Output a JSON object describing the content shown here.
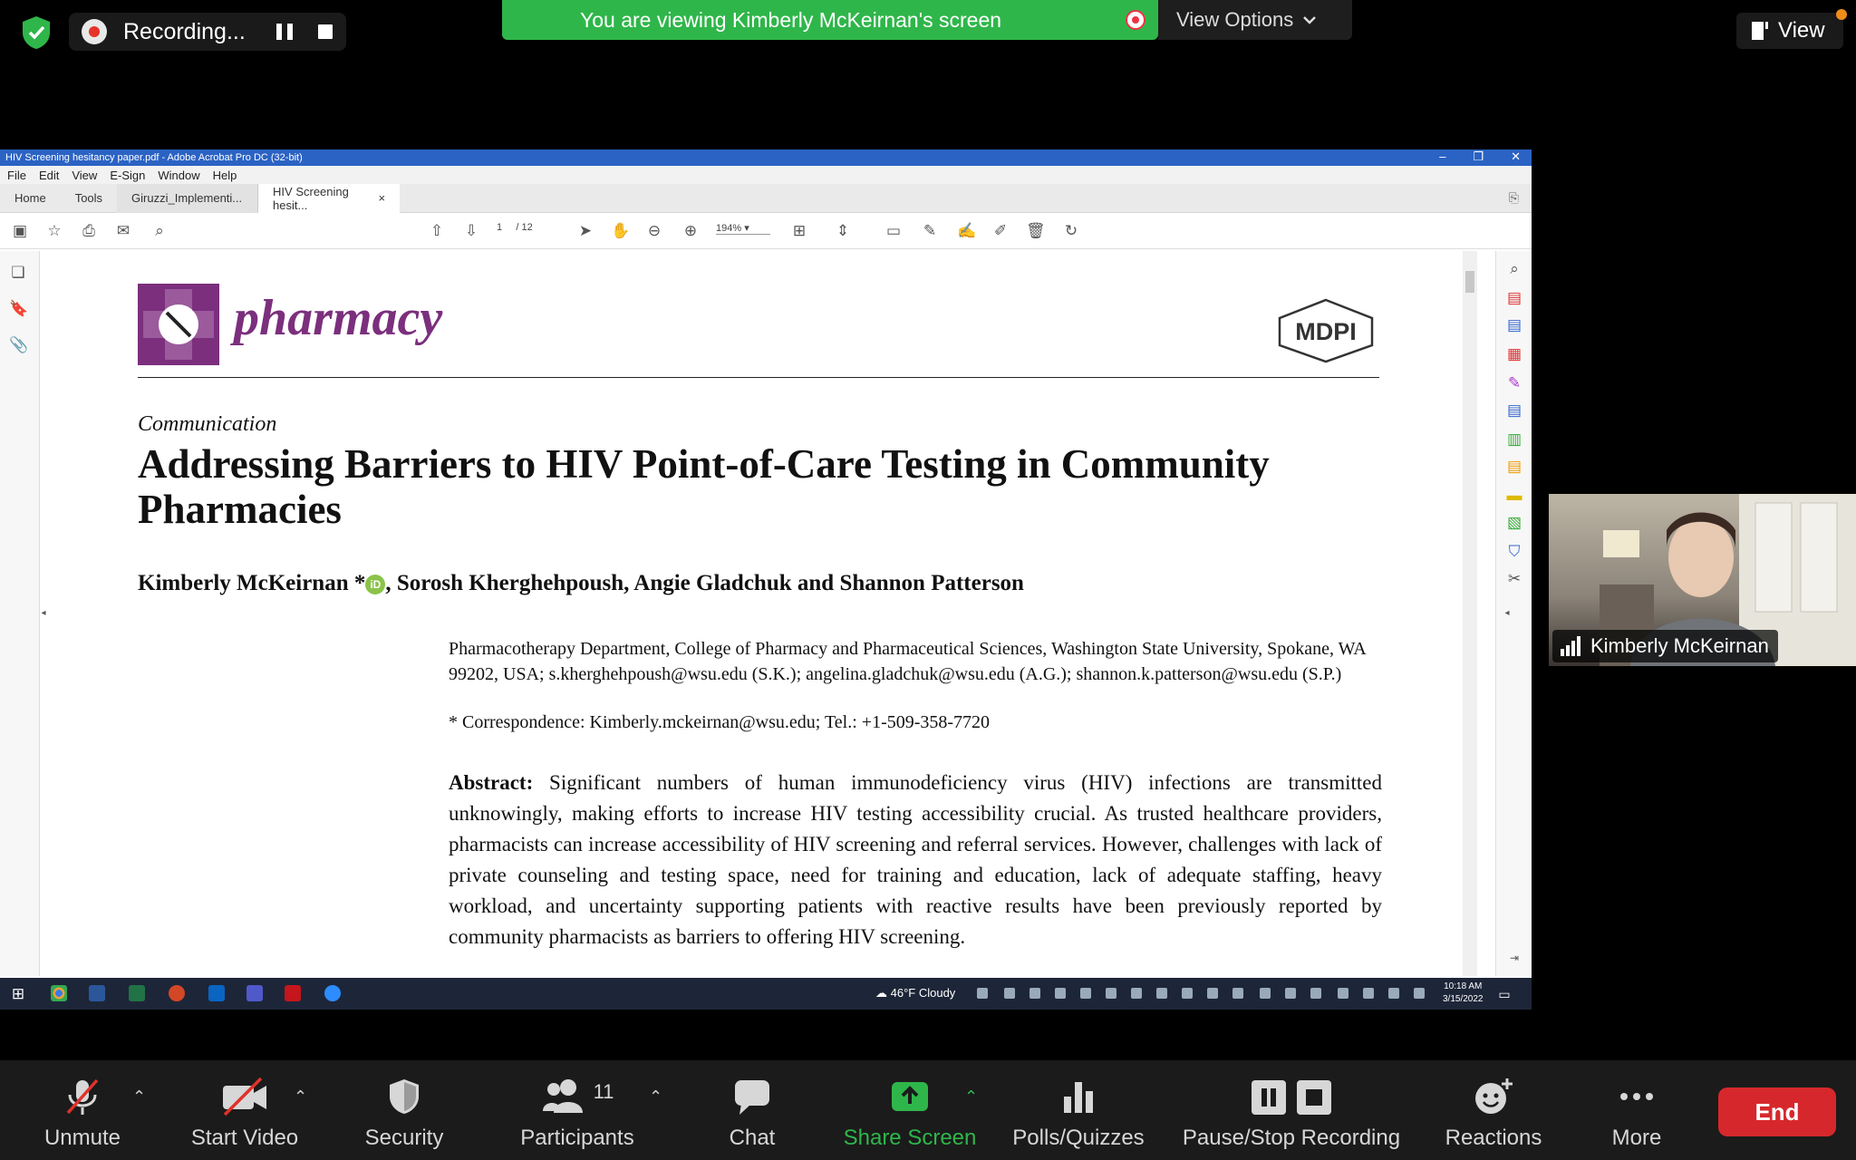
{
  "zoom_top": {
    "recording_label": "Recording...",
    "viewing_banner": "You are viewing Kimberly McKeirnan's screen",
    "view_options": "View Options",
    "view_button": "View"
  },
  "acrobat": {
    "window_title": "HIV Screening hesitancy paper.pdf - Adobe Acrobat Pro DC (32-bit)",
    "menu": [
      "File",
      "Edit",
      "View",
      "E-Sign",
      "Window",
      "Help"
    ],
    "tabs": {
      "home": "Home",
      "tools": "Tools",
      "doc1": "Giruzzi_Implementi...",
      "doc2": "HIV Screening hesit..."
    },
    "page_current": "1",
    "page_total": "/ 12",
    "zoom": "194%"
  },
  "document": {
    "journal": "pharmacy",
    "publisher": "MDPI",
    "type": "Communication",
    "title": "Addressing Barriers to HIV Point-of-Care Testing in Community Pharmacies",
    "authors_a": "Kimberly McKeirnan *",
    "orcid": "iD",
    "authors_b": ", Sorosh Kherghehpoush, Angie Gladchuk and Shannon Patterson",
    "affiliation": "Pharmacotherapy Department, College of Pharmacy and Pharmaceutical Sciences, Washington State University, Spokane, WA 99202, USA; s.kherghehpoush@wsu.edu (S.K.); angelina.gladchuk@wsu.edu (A.G.); shannon.k.patterson@wsu.edu (S.P.)",
    "correspondence": "*  Correspondence: Kimberly.mckeirnan@wsu.edu; Tel.: +1-509-358-7720",
    "abstract_label": "Abstract:",
    "abstract_text": "Significant numbers of human immunodeficiency virus (HIV) infections are transmitted unknowingly, making efforts to increase HIV testing accessibility crucial.  As trusted healthcare providers, pharmacists can increase accessibility of HIV screening and referral services. However, challenges with lack of private counseling and testing space, need for training and education, lack of adequate staffing, heavy workload, and uncertainty supporting patients with reactive results have been previously reported by community pharmacists as barriers to offering HIV screening."
  },
  "taskbar": {
    "weather": "46°F  Cloudy",
    "time": "10:18 AM",
    "date": "3/15/2022"
  },
  "self_video": {
    "name": "Kimberly McKeirnan"
  },
  "controls": {
    "unmute": "Unmute",
    "start_video": "Start Video",
    "security": "Security",
    "participants": "Participants",
    "participants_count": "11",
    "chat": "Chat",
    "share_screen": "Share Screen",
    "polls": "Polls/Quizzes",
    "pause_stop": "Pause/Stop Recording",
    "reactions": "Reactions",
    "more": "More",
    "end": "End"
  },
  "colors": {
    "share_green": "#2fb64a",
    "end_red": "#d6282c",
    "journal_purple": "#7b2f7d",
    "acrobat_blue": "#2b63c4"
  }
}
